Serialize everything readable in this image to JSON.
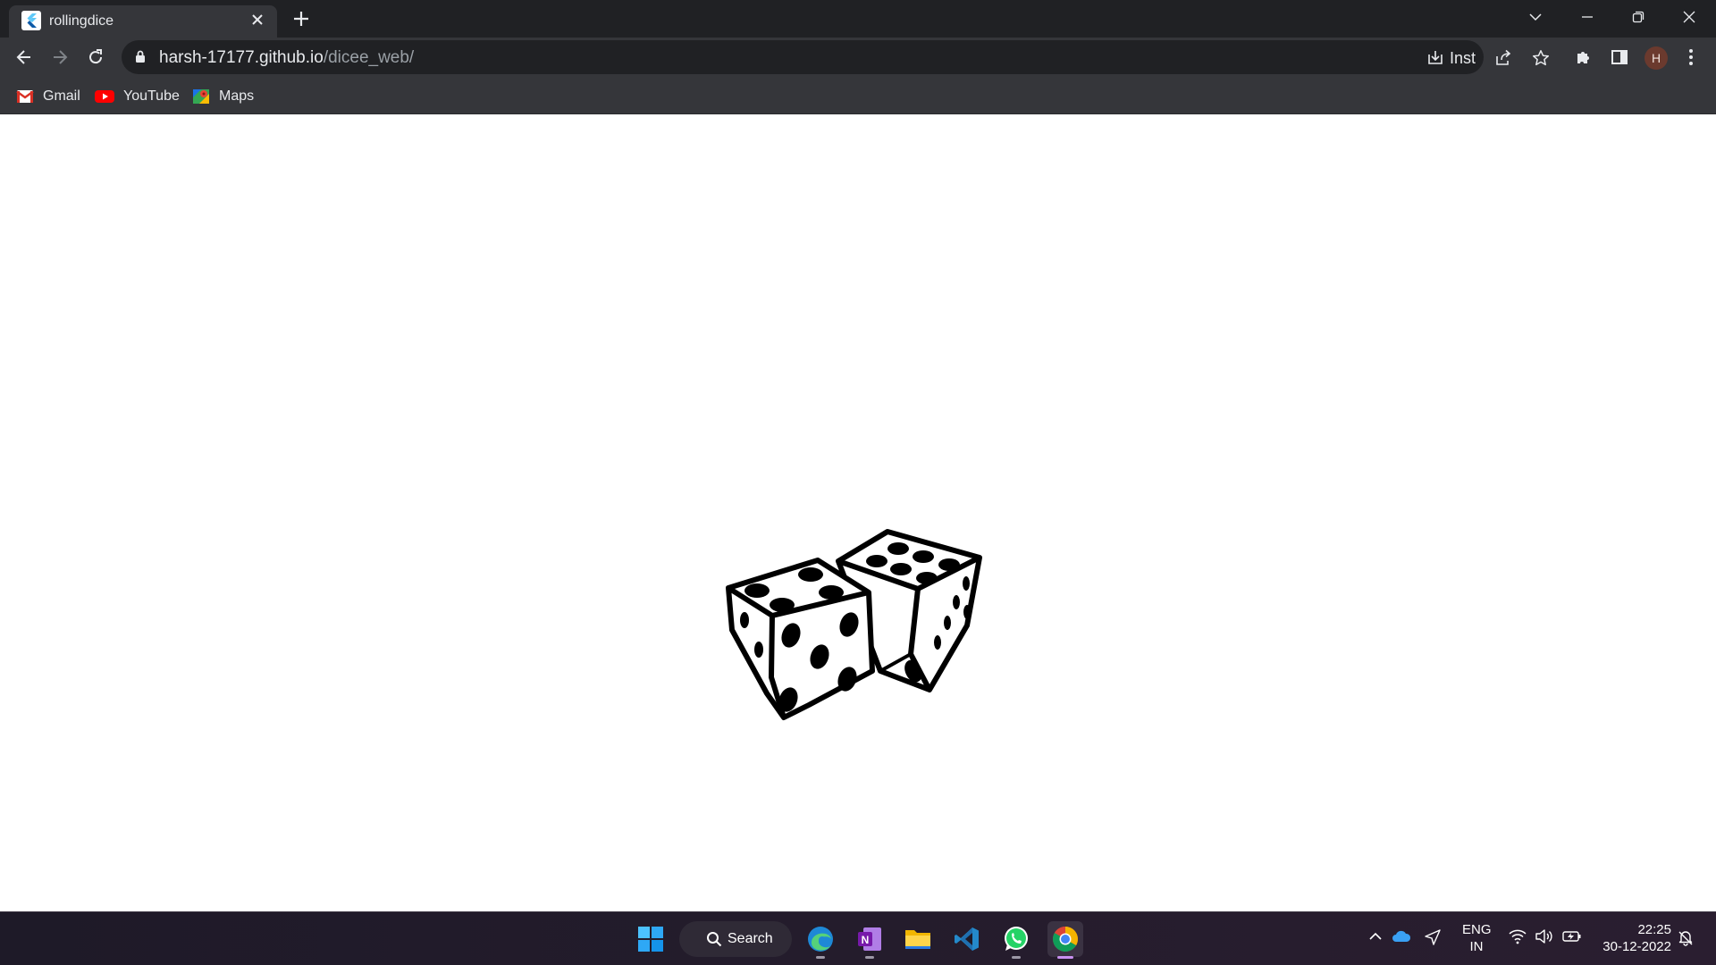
{
  "browser": {
    "tab": {
      "title": "rollingdice",
      "close_icon": "close-icon"
    },
    "address": {
      "host": "harsh-17177.github.io",
      "path": "/dicee_web/"
    },
    "install_label": "Inst",
    "profile_initial": "H",
    "bookmarks": [
      {
        "label": "Gmail",
        "icon": "gmail-icon"
      },
      {
        "label": "YouTube",
        "icon": "youtube-icon"
      },
      {
        "label": "Maps",
        "icon": "maps-icon"
      }
    ]
  },
  "page": {
    "image": "dice-image"
  },
  "taskbar": {
    "search_label": "Search",
    "apps": [
      "start-icon",
      "edge-icon",
      "onenote-icon",
      "file-explorer-icon",
      "vscode-icon",
      "whatsapp-icon",
      "chrome-icon"
    ],
    "language": {
      "line1": "ENG",
      "line2": "IN"
    },
    "time": "22:25",
    "date": "30-12-2022"
  }
}
